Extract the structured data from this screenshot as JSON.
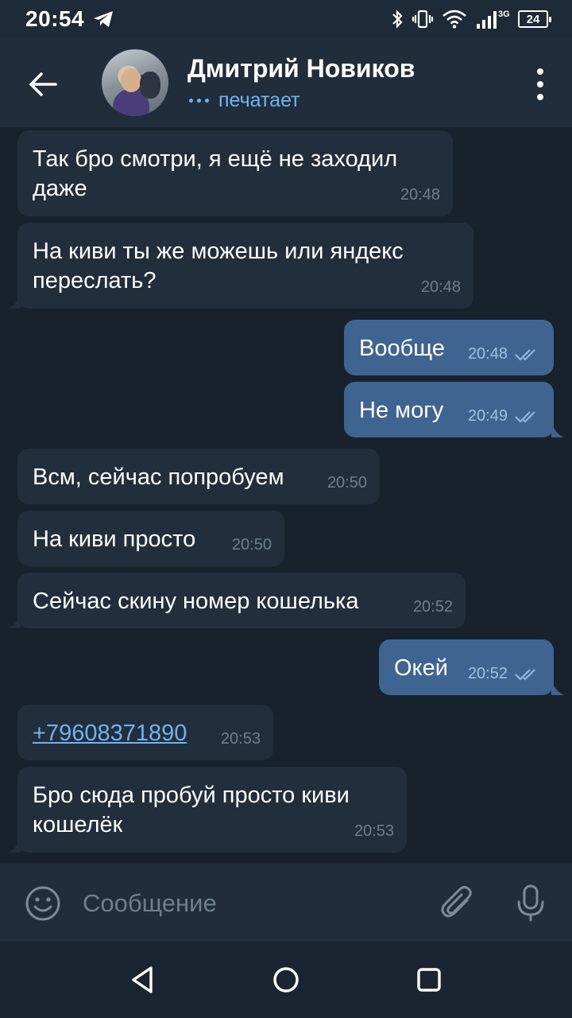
{
  "status_bar": {
    "time": "20:54",
    "network": "3G",
    "battery": "24",
    "icons": [
      "telegram-icon",
      "bluetooth-icon",
      "vibrate-icon",
      "wifi-icon",
      "signal-icon",
      "battery-icon"
    ]
  },
  "header": {
    "contact_name": "Дмитрий Новиков",
    "status": "печатает"
  },
  "messages": [
    {
      "dir": "in",
      "text_line1": "Так бро смотри, я ещё не заходил",
      "text_line2": "даже",
      "time": "20:48"
    },
    {
      "dir": "in",
      "text_line1": "На киви ты же можешь или яндекс",
      "text_line2": "переслать?",
      "time": "20:48"
    },
    {
      "dir": "out",
      "text": "Вообще",
      "time": "20:48",
      "read": true
    },
    {
      "dir": "out",
      "text": "Не могу",
      "time": "20:49",
      "read": true
    },
    {
      "dir": "in",
      "text": "Всм, сейчас попробуем",
      "time": "20:50"
    },
    {
      "dir": "in",
      "text": "На киви просто",
      "time": "20:50"
    },
    {
      "dir": "in",
      "text": "Сейчас скину номер кошелька",
      "time": "20:52"
    },
    {
      "dir": "out",
      "text": "Окей",
      "time": "20:52",
      "read": true
    },
    {
      "dir": "in",
      "text": "+79608371890",
      "time": "20:53",
      "is_link": true
    },
    {
      "dir": "in",
      "text_line1": "Бро сюда пробуй просто киви",
      "text_line2": "кошелёк",
      "time": "20:53"
    }
  ],
  "input": {
    "placeholder": "Сообщение",
    "value": ""
  },
  "colors": {
    "background": "#18222d",
    "header": "#212d3b",
    "incoming_bubble": "#232e3c",
    "outgoing_bubble": "#3f6491",
    "accent": "#6eb6f1"
  }
}
